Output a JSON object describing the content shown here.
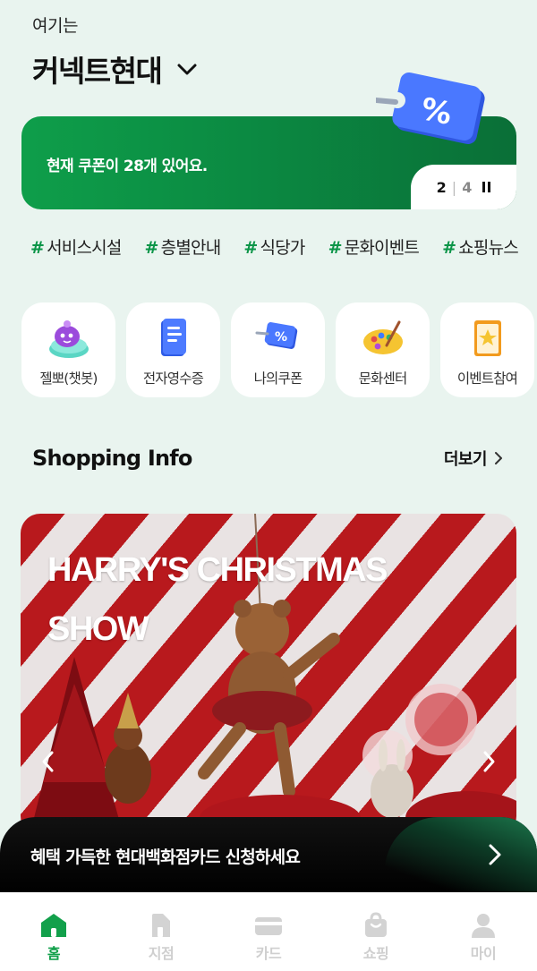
{
  "header": {
    "subtitle": "여기는",
    "store_name": "커넥트현대"
  },
  "coupon_banner": {
    "text": "현재 쿠폰이 28개 있어요.",
    "page_current": "2",
    "page_separator": "|",
    "page_total": "4"
  },
  "tags": [
    {
      "hash": "#",
      "label": "서비스시설"
    },
    {
      "hash": "#",
      "label": "층별안내"
    },
    {
      "hash": "#",
      "label": "식당가"
    },
    {
      "hash": "#",
      "label": "문화이벤트"
    },
    {
      "hash": "#",
      "label": "쇼핑뉴스"
    }
  ],
  "shortcuts": [
    {
      "label": "젤뽀(챗봇)",
      "icon": "chatbot-icon"
    },
    {
      "label": "전자영수증",
      "icon": "receipt-icon"
    },
    {
      "label": "나의쿠폰",
      "icon": "coupon-icon"
    },
    {
      "label": "문화센터",
      "icon": "palette-icon"
    },
    {
      "label": "이벤트참여",
      "icon": "event-icon"
    }
  ],
  "section": {
    "title": "Shopping Info",
    "more_label": "더보기"
  },
  "promo": {
    "title": "HARRY'S CHRISTMAS SHOW"
  },
  "card_banner": {
    "text": "혜택 가득한 현대백화점카드 신청하세요"
  },
  "tabbar": [
    {
      "label": "홈",
      "icon": "home-icon",
      "active": true
    },
    {
      "label": "지점",
      "icon": "store-icon",
      "active": false
    },
    {
      "label": "카드",
      "icon": "card-icon",
      "active": false
    },
    {
      "label": "쇼핑",
      "icon": "shopping-bag-icon",
      "active": false
    },
    {
      "label": "마이",
      "icon": "user-icon",
      "active": false
    }
  ],
  "colors": {
    "brand_green": "#0b9548",
    "background": "#e9f4ef",
    "promo_red": "#b8191d"
  }
}
